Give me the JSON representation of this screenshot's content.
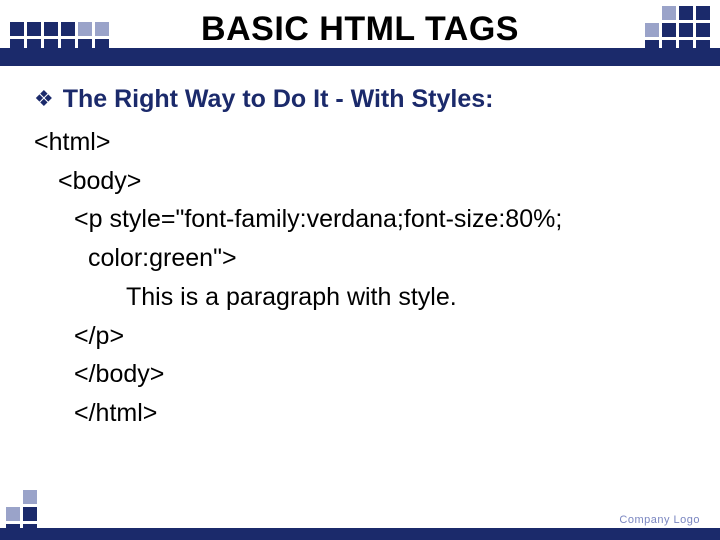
{
  "title": "BASIC HTML TAGS",
  "heading": "The Right Way to Do It - With Styles:",
  "code": {
    "l1": "<html>",
    "l2": "<body>",
    "l3": "<p style=\"font-family:verdana;font-size:80%;",
    "l4": "color:green\">",
    "l5": "This is a paragraph with style.",
    "l6": "</p>",
    "l7": "</body>",
    "l8": "</html>"
  },
  "footer_label": "Company Logo"
}
